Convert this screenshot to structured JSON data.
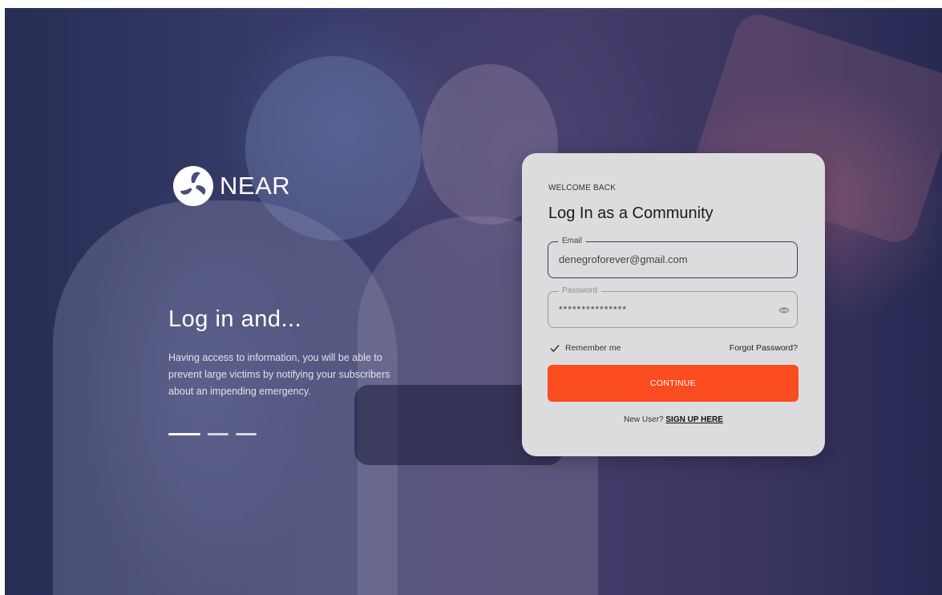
{
  "brand": {
    "name": "NEAR",
    "logo_icon": "near-logo-icon"
  },
  "hero": {
    "title": "Log in and...",
    "description": "Having access to information, you will be able to prevent large victims by notifying your subscribers about an impending emergency.",
    "slide_count": 3,
    "active_slide": 1
  },
  "login": {
    "eyebrow": "WELCOME BACK",
    "title": "Log In as a Community",
    "email": {
      "label": "Email",
      "value": "denegroforever@gmail.com"
    },
    "password": {
      "label": "Password",
      "value": "***************",
      "toggle_icon": "eye-icon"
    },
    "remember_label": "Remember me",
    "remember_checked": true,
    "forgot_label": "Forgot Password?",
    "continue_label": "CONTINUE",
    "new_user_prefix": "New User?",
    "signup_label": "SIGN UP HERE"
  },
  "colors": {
    "accent": "#fb4c20",
    "card_bg": "#dcdcdf",
    "text_dark": "#1b1b1b"
  }
}
